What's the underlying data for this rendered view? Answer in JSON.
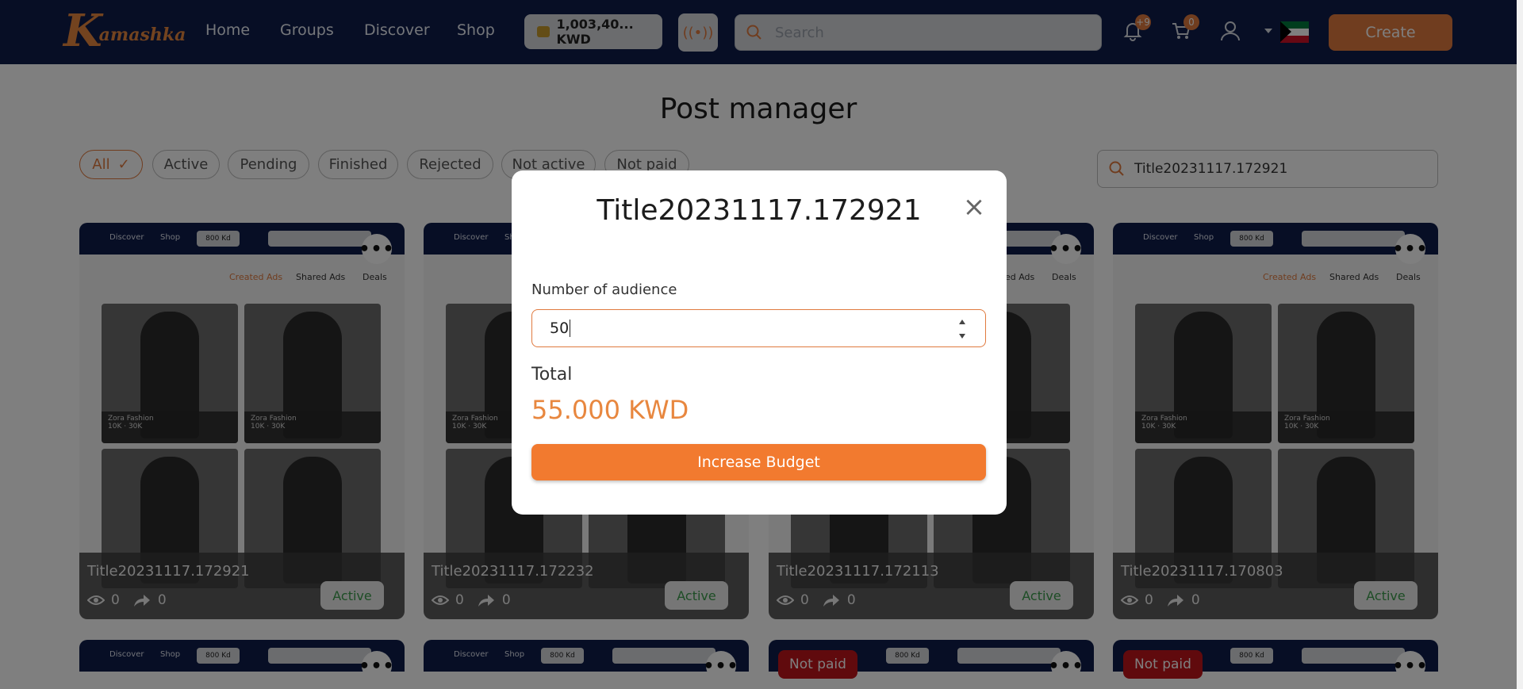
{
  "nav": {
    "logo_letter": "K",
    "logo_rest": "amashka",
    "links": [
      "Home",
      "Groups",
      "Discover",
      "Shop"
    ],
    "balance": "1,003,40... KWD",
    "search_placeholder": "Search",
    "notif_count": "+9",
    "cart_count": "0",
    "create_label": "Create",
    "accent_color": "#e07a3f",
    "bar_color": "#0f1d4a"
  },
  "page": {
    "title": "Post manager",
    "filters": [
      "All",
      "Active",
      "Pending",
      "Finished",
      "Rejected",
      "Not active",
      "Not paid"
    ],
    "selected_filter": "All",
    "search_value": "Title20231117.172921"
  },
  "preview": {
    "nav_items": [
      "Discover",
      "Shop"
    ],
    "balance": "800 Kd",
    "search": "Search",
    "tabs": [
      "Created Ads",
      "Shared Ads",
      "Deals"
    ],
    "tile_brand": "Zora Fashion",
    "tile_views": "10K",
    "tile_shares": "30K"
  },
  "posts": [
    {
      "title": "Title20231117.172921",
      "views": "0",
      "shares": "0",
      "status": "Active"
    },
    {
      "title": "Title20231117.172232",
      "views": "0",
      "shares": "0",
      "status": "Active"
    },
    {
      "title": "Title20231117.172113",
      "views": "0",
      "shares": "0",
      "status": "Active"
    },
    {
      "title": "Title20231117.170803",
      "views": "0",
      "shares": "0",
      "status": "Active"
    }
  ],
  "row2": {
    "not_paid_label": "Not paid"
  },
  "modal": {
    "title": "Title20231117.172921",
    "audience_label": "Number of audience",
    "audience_value": "50",
    "total_label": "Total",
    "total_value": "55.000 KWD",
    "button_label": "Increase Budget"
  }
}
